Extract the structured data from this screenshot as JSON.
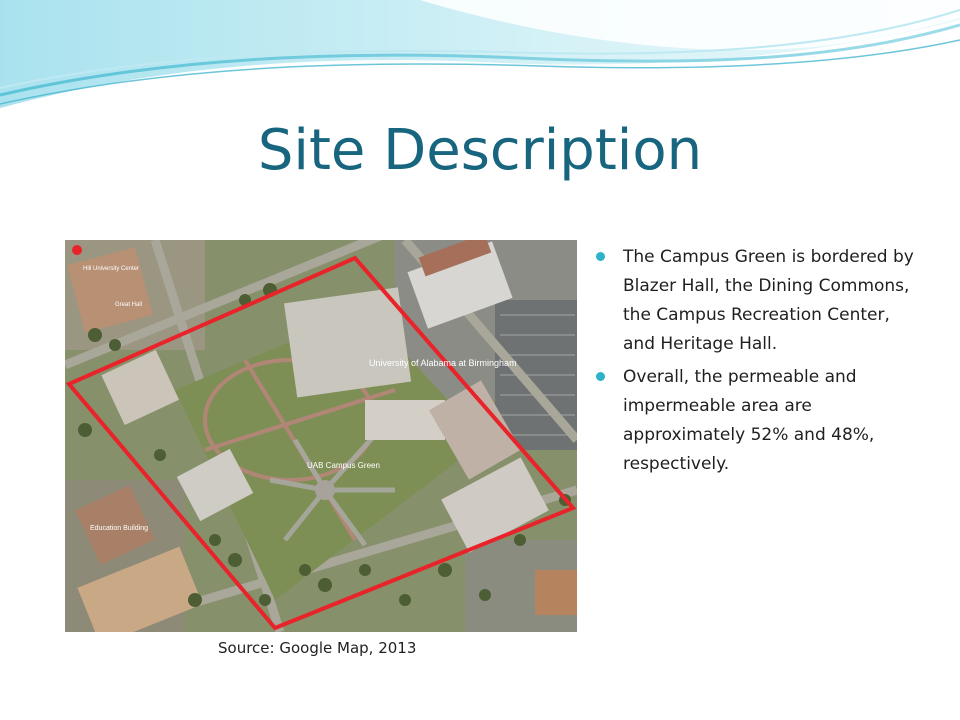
{
  "slide": {
    "title": "Site Description",
    "bullets": [
      "The Campus Green is bordered by Blazer Hall, the Dining Commons, the Campus Recreation Center, and Heritage Hall.",
      "Overall, the permeable and impermeable area are approximately 52%  and 48%, respectively."
    ],
    "source_caption": "Source: Google Map, 2013"
  },
  "map": {
    "labels": {
      "uab": "University of Alabama at Birmingham",
      "campus_green": "UAB Campus Green",
      "education": "Education Building",
      "great_hall": "Great Hall",
      "hill_center": "Hill University Center"
    }
  },
  "colors": {
    "title": "#17657e",
    "bullet": "#2bb3c9",
    "outline": "#e8232a",
    "wave_light": "#cdeef5",
    "wave_mid": "#7fd0e2",
    "wave_dark": "#3fb2cb"
  }
}
